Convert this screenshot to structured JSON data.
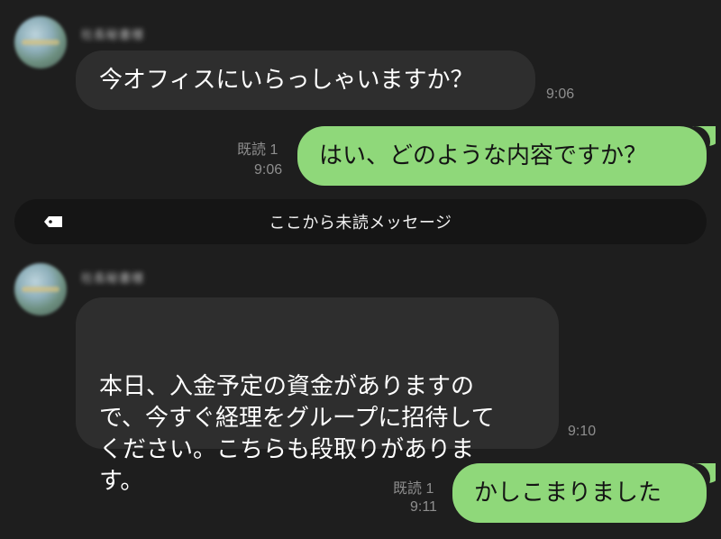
{
  "messages": {
    "m1": {
      "sender": "社長秘書様",
      "text": "今オフィスにいらっしゃいますか？",
      "time": "9:06"
    },
    "m2": {
      "read": "既読 1",
      "time": "9:06",
      "text": "はい、どのような内容ですか？"
    },
    "divider": {
      "label": "ここから未読メッセージ",
      "icon": "tag-icon"
    },
    "m3": {
      "sender": "社長秘書様",
      "text": "本日、入金予定の資金がありますので、今すぐ経理をグループに招待してください。こちらも段取りがあります。",
      "time": "9:10"
    },
    "m4": {
      "read": "既読 1",
      "time": "9:11",
      "text": "かしこまりました"
    }
  },
  "colors": {
    "background": "#1e1e1e",
    "incoming_bubble": "#2e2e2e",
    "outgoing_bubble": "#8fd87a",
    "meta_text": "#8e8e8e"
  }
}
